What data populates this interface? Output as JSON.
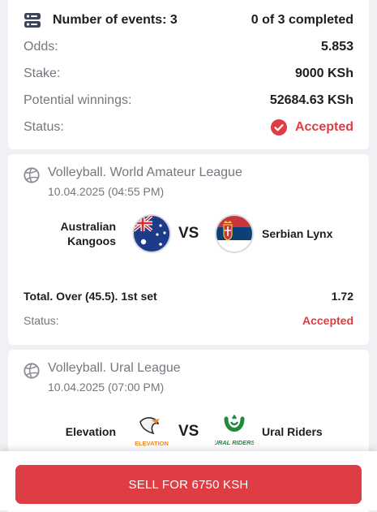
{
  "summary": {
    "events_label": "Number of events: 3",
    "completed": "0 of 3 completed",
    "odds_label": "Odds:",
    "odds_value": "5.853",
    "stake_label": "Stake:",
    "stake_value": "9000 KSh",
    "winnings_label": "Potential winnings:",
    "winnings_value": "52684.63 KSh",
    "status_label": "Status:",
    "status_value": "Accepted"
  },
  "events": [
    {
      "league": "Volleyball. World Amateur League",
      "datetime": "10.04.2025 (04:55 PM)",
      "team1": "Australian\nKangoos",
      "team2": "Serbian Lynx",
      "vs": "VS",
      "bet": "Total. Over (45.5). 1st set",
      "odds": "1.72",
      "status_label": "Status:",
      "status_value": "Accepted"
    },
    {
      "league": "Volleyball. Ural League",
      "datetime": "10.04.2025 (07:00 PM)",
      "team1": "Elevation",
      "team2": "Ural Riders",
      "vs": "VS",
      "logo1_text": "ELEVATION",
      "logo2_text": "URAL RIDERS"
    }
  ],
  "sell_button": "SELL FOR 6750 KSH",
  "colors": {
    "accent": "#df3d44",
    "muted": "#74777e",
    "background": "#f0f1f4"
  },
  "icons": [
    "events-icon",
    "check-circle-icon",
    "volleyball-icon",
    "australia-flag-icon",
    "serbia-flag-icon",
    "elevation-logo",
    "ural-riders-logo"
  ]
}
